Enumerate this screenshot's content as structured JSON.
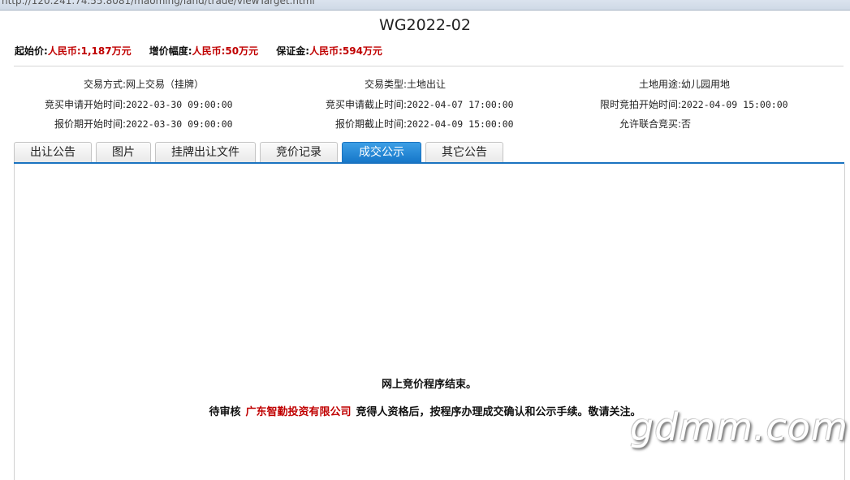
{
  "browser": {
    "url": "http://120.241.74.55:8081/maoming/land/trade/viewTarget.html"
  },
  "page": {
    "title": "WG2022-02"
  },
  "prices": {
    "start_label": "起始价:",
    "start_value": "人民币:1,187万元",
    "increment_label": "增价幅度:",
    "increment_value": "人民币:50万元",
    "deposit_label": "保证金:",
    "deposit_value": "人民币:594万元"
  },
  "info": {
    "trade_method_label": "交易方式:",
    "trade_method_value": "网上交易（挂牌）",
    "apply_start_label": "竞买申请开始时间:",
    "apply_start_value": "2022-03-30 09:00:00",
    "quote_start_label": "报价期开始时间:",
    "quote_start_value": "2022-03-30 09:00:00",
    "trade_type_label": "交易类型:",
    "trade_type_value": "土地出让",
    "apply_end_label": "竞买申请截止时间:",
    "apply_end_value": "2022-04-07 17:00:00",
    "quote_end_label": "报价期截止时间:",
    "quote_end_value": "2022-04-09 15:00:00",
    "land_use_label": "土地用途:",
    "land_use_value": "幼儿园用地",
    "limited_start_label": "限时竞拍开始时间:",
    "limited_start_value": "2022-04-09 15:00:00",
    "joint_label": "允许联合竞买:",
    "joint_value": "否"
  },
  "tabs": [
    {
      "label": "出让公告"
    },
    {
      "label": "图片"
    },
    {
      "label": "挂牌出让文件"
    },
    {
      "label": "竞价记录"
    },
    {
      "label": "成交公示"
    },
    {
      "label": "其它公告"
    }
  ],
  "result": {
    "line1": "网上竞价程序结束。",
    "line2_prefix": "待审核",
    "winner": "广东智勤投资有限公司",
    "line2_suffix": "竞得人资格后，按程序办理成交确认和公示手续。敬请关注。"
  },
  "watermark": "gdmm.com",
  "colors": {
    "accent_blue": "#1a73c0",
    "highlight_red": "#c00000"
  }
}
